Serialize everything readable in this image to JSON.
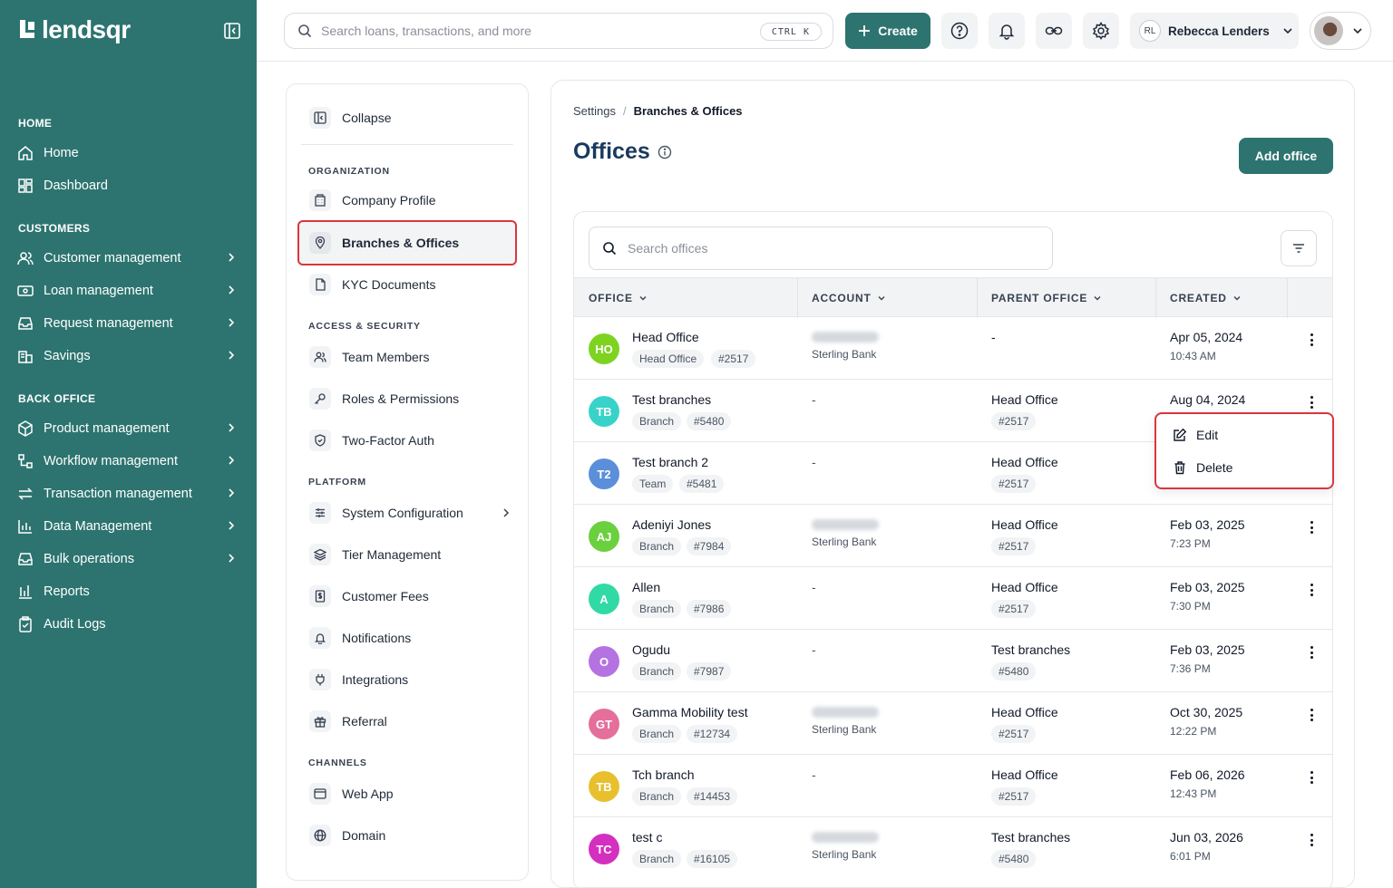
{
  "brand": {
    "name": "lendsqr"
  },
  "sidebar": {
    "sections": [
      {
        "title": "HOME",
        "items": [
          {
            "label": "Home",
            "icon": "home-icon"
          },
          {
            "label": "Dashboard",
            "icon": "dashboard-icon"
          }
        ]
      },
      {
        "title": "CUSTOMERS",
        "items": [
          {
            "label": "Customer management",
            "icon": "users-icon",
            "expandable": true
          },
          {
            "label": "Loan management",
            "icon": "cash-icon",
            "expandable": true
          },
          {
            "label": "Request management",
            "icon": "inbox-icon",
            "expandable": true
          },
          {
            "label": "Savings",
            "icon": "bank-icon",
            "expandable": true
          }
        ]
      },
      {
        "title": "BACK OFFICE",
        "items": [
          {
            "label": "Product management",
            "icon": "box-icon",
            "expandable": true
          },
          {
            "label": "Workflow management",
            "icon": "workflow-icon",
            "expandable": true
          },
          {
            "label": "Transaction management",
            "icon": "transfer-icon",
            "expandable": true
          },
          {
            "label": "Data Management",
            "icon": "chart-icon",
            "expandable": true
          },
          {
            "label": "Bulk operations",
            "icon": "inbox-icon",
            "expandable": true
          },
          {
            "label": "Reports",
            "icon": "report-icon"
          },
          {
            "label": "Audit Logs",
            "icon": "clipboard-icon"
          }
        ]
      }
    ]
  },
  "topbar": {
    "search_placeholder": "Search loans, transactions, and more",
    "shortcut": "CTRL K",
    "create_label": "Create",
    "user_initials": "RL",
    "user_name": "Rebecca Lenders"
  },
  "settings_nav": {
    "collapse_label": "Collapse",
    "organization_title": "ORGANIZATION",
    "company_profile": "Company Profile",
    "branches_offices": "Branches & Offices",
    "kyc_documents": "KYC Documents",
    "access_title": "ACCESS & SECURITY",
    "team_members": "Team Members",
    "roles_permissions": "Roles & Permissions",
    "two_factor": "Two-Factor Auth",
    "platform_title": "PLATFORM",
    "system_configuration": "System Configuration",
    "tier_management": "Tier Management",
    "customer_fees": "Customer Fees",
    "notifications": "Notifications",
    "integrations": "Integrations",
    "referral": "Referral",
    "channels_title": "CHANNELS",
    "web_app": "Web App",
    "domain": "Domain"
  },
  "main": {
    "breadcrumb_parent": "Settings",
    "breadcrumb_sep": "/",
    "breadcrumb_current": "Branches & Offices",
    "title": "Offices",
    "add_office_label": "Add office",
    "search_placeholder": "Search offices",
    "columns": {
      "office": "OFFICE",
      "account": "ACCOUNT",
      "parent": "PARENT OFFICE",
      "created": "CREATED"
    },
    "rows": [
      {
        "initials": "HO",
        "color": "#7ed321",
        "name": "Head Office",
        "type": "Head Office",
        "code": "#2517",
        "account_bank": "Sterling Bank",
        "parent": "-",
        "parent_code": "",
        "date": "Apr 05, 2024",
        "time": "10:43 AM"
      },
      {
        "initials": "TB",
        "color": "#38d3c8",
        "name": "Test branches",
        "type": "Branch",
        "code": "#5480",
        "account_bank": "",
        "parent": "Head Office",
        "parent_code": "#2517",
        "date": "Aug 04, 2024",
        "time": ""
      },
      {
        "initials": "T2",
        "color": "#5b8fd9",
        "name": "Test branch 2",
        "type": "Team",
        "code": "#5481",
        "account_bank": "",
        "parent": "Head Office",
        "parent_code": "#2517",
        "date": "",
        "time": ""
      },
      {
        "initials": "AJ",
        "color": "#6bd03e",
        "name": "Adeniyi Jones",
        "type": "Branch",
        "code": "#7984",
        "account_bank": "Sterling Bank",
        "parent": "Head Office",
        "parent_code": "#2517",
        "date": "Feb 03, 2025",
        "time": "7:23 PM"
      },
      {
        "initials": "A",
        "color": "#31d9a5",
        "name": "Allen",
        "type": "Branch",
        "code": "#7986",
        "account_bank": "",
        "parent": "Head Office",
        "parent_code": "#2517",
        "date": "Feb 03, 2025",
        "time": "7:30 PM"
      },
      {
        "initials": "O",
        "color": "#b473e0",
        "name": "Ogudu",
        "type": "Branch",
        "code": "#7987",
        "account_bank": "",
        "parent": "Test branches",
        "parent_code": "#5480",
        "date": "Feb 03, 2025",
        "time": "7:36 PM"
      },
      {
        "initials": "GT",
        "color": "#e46f9a",
        "name": "Gamma Mobility test",
        "type": "Branch",
        "code": "#12734",
        "account_bank": "Sterling Bank",
        "parent": "Head Office",
        "parent_code": "#2517",
        "date": "Oct 30, 2025",
        "time": "12:22 PM"
      },
      {
        "initials": "TB",
        "color": "#e8c02e",
        "name": "Tch branch",
        "type": "Branch",
        "code": "#14453",
        "account_bank": "",
        "parent": "Head Office",
        "parent_code": "#2517",
        "date": "Feb 06, 2026",
        "time": "12:43 PM"
      },
      {
        "initials": "TC",
        "color": "#d52fc0",
        "name": "test c",
        "type": "Branch",
        "code": "#16105",
        "account_bank": "Sterling Bank",
        "parent": "Test branches",
        "parent_code": "#5480",
        "date": "Jun 03, 2026",
        "time": "6:01 PM"
      }
    ],
    "context_menu": {
      "edit": "Edit",
      "delete": "Delete"
    }
  },
  "colors": {
    "brand": "#2d7470",
    "title": "#1a3a5e",
    "highlight": "#d9363e"
  }
}
